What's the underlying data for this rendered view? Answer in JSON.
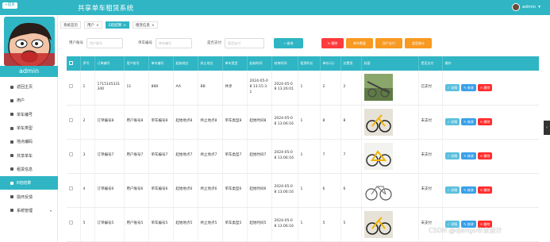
{
  "header": {
    "back_label": "<首页",
    "title": "共享单车租赁系统",
    "user_name": "admin"
  },
  "sidebar": {
    "user_name": "admin",
    "items": [
      {
        "label": "返回主页",
        "icon": "home-icon"
      },
      {
        "label": "用户",
        "icon": "user-icon"
      },
      {
        "label": "单车编号",
        "icon": "tag-icon"
      },
      {
        "label": "单车类型",
        "icon": "tag-icon"
      },
      {
        "label": "地点编码",
        "icon": "location-icon"
      },
      {
        "label": "共享单车",
        "icon": "bike-icon"
      },
      {
        "label": "租赁信息",
        "icon": "doc-icon"
      },
      {
        "label": "E结结算",
        "icon": "settle-icon"
      },
      {
        "label": "损坏反馈",
        "icon": "feedback-icon"
      },
      {
        "label": "系统管理",
        "icon": "settings-icon"
      }
    ]
  },
  "tabs": [
    {
      "label": "系统首页",
      "closable": false
    },
    {
      "label": "用户",
      "closable": true
    },
    {
      "label": "E结结算",
      "closable": true
    },
    {
      "label": "租赁信息",
      "closable": true
    }
  ],
  "search": {
    "user_label": "用户账号",
    "user_placeholder": "用户账号",
    "bike_label": "单车编号",
    "bike_placeholder": "单车编号",
    "paid_label": "是否支付",
    "paid_placeholder": "是否支付",
    "search_button": "查询",
    "delete_button": "删除",
    "btn_bike_stats": "单车数量",
    "btn_user_stats": "用户支付",
    "btn_type_stats": "类型统计"
  },
  "table": {
    "columns": [
      "",
      "序号",
      "订单编号",
      "用户账号",
      "单车编号",
      "起始地点",
      "终止地点",
      "单车类型",
      "起始时间",
      "结束时间",
      "租赁时长",
      "单价(元)",
      "总费用",
      "封面",
      "是否支付",
      "操作"
    ],
    "actions": {
      "detail": "详情",
      "edit": "修改",
      "delete": "删除"
    },
    "rows": [
      {
        "index": "1",
        "order_no": "1715145331340",
        "user": "11",
        "bike_no": "888",
        "start": "AA",
        "end": "BB",
        "type": "共享",
        "start_time": "2024-05-08 13:15:31",
        "end_time": "2024-05-08 13:26:01",
        "duration": "1",
        "price": "2",
        "total": "2",
        "paid": "已支付"
      },
      {
        "index": "2",
        "order_no": "订单编号8",
        "user": "用户账号8",
        "bike_no": "单车编号8",
        "start": "起始地点8",
        "end": "终止地点8",
        "type": "单车类型8",
        "start_time": "起始时间8",
        "end_time": "2024-05-08 13:06:16",
        "duration": "1",
        "price": "8",
        "total": "8",
        "paid": "未支付"
      },
      {
        "index": "3",
        "order_no": "订单编号7",
        "user": "用户账号7",
        "bike_no": "单车编号7",
        "start": "起始地点7",
        "end": "终止地点7",
        "type": "单车类型7",
        "start_time": "起始时间7",
        "end_time": "2024-05-08 13:06:16",
        "duration": "1",
        "price": "7",
        "total": "7",
        "paid": "未支付"
      },
      {
        "index": "4",
        "order_no": "订单编号6",
        "user": "用户账号6",
        "bike_no": "单车编号6",
        "start": "起始地点6",
        "end": "终止地点6",
        "type": "单车类型6",
        "start_time": "起始时间6",
        "end_time": "2024-05-08 13:06:16",
        "duration": "1",
        "price": "6",
        "total": "6",
        "paid": "未支付"
      },
      {
        "index": "5",
        "order_no": "订单编号5",
        "user": "用户账号5",
        "bike_no": "单车编号5",
        "start": "起始地点5",
        "end": "终止地点5",
        "type": "单车类型5",
        "start_time": "起始时间5",
        "end_time": "2024-05-08 13:06:16",
        "duration": "1",
        "price": "5",
        "total": "5",
        "paid": "未支付"
      }
    ]
  },
  "watermark": "CSDN @django毕业设计",
  "colors": {
    "accent": "#2fb5c4",
    "danger": "#ff3b3b",
    "orange": "#f89922"
  }
}
